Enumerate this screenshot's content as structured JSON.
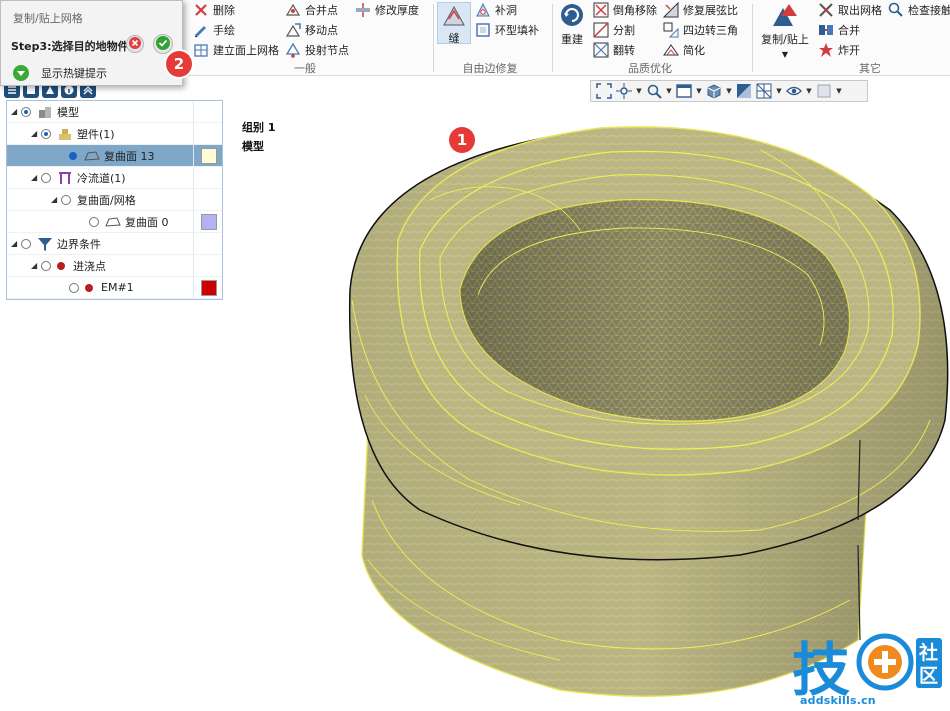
{
  "dialog": {
    "title": "复制/贴上网格",
    "step": "Step3:选择目的地物件",
    "hint": "显示热键提示"
  },
  "callouts": {
    "model": "1",
    "confirm": "2"
  },
  "ribbon": {
    "col1": [
      "删除",
      "手绘",
      "建立面上网格"
    ],
    "col2": [
      "合并点",
      "移动点",
      "投射节点"
    ],
    "col3": [
      "修改厚度"
    ],
    "group_general": "一般",
    "sew": "缝",
    "col4": [
      "补洞",
      "环型填补"
    ],
    "group_free_edge": "自由边修复",
    "rebuild": "重建",
    "col5": [
      "倒角移除",
      "分割",
      "翻转"
    ],
    "col6": [
      "修复展弦比",
      "四边转三角",
      "简化"
    ],
    "group_quality": "品质优化",
    "copy_paste": "复制/贴上",
    "col7": [
      "取出网格",
      "合并",
      "炸开"
    ],
    "check": "检查接触",
    "group_other": "其它"
  },
  "tree": {
    "rows": [
      {
        "label": "模型",
        "depth": 0,
        "expand": "◢",
        "radio": "on",
        "icon": "model",
        "swatch": ""
      },
      {
        "label": "塑件(1)",
        "depth": 1,
        "expand": "◢",
        "radio": "on",
        "icon": "part",
        "swatch": ""
      },
      {
        "label": "复曲面 13",
        "depth": 3,
        "expand": "",
        "radio": "dot",
        "icon": "surface",
        "swatch": "#fffbd6",
        "selected": true
      },
      {
        "label": "冷流道(1)",
        "depth": 1,
        "expand": "◢",
        "radio": "off",
        "icon": "runner",
        "swatch": ""
      },
      {
        "label": "复曲面/网格",
        "depth": 2,
        "expand": "◢",
        "radio": "off",
        "icon": "",
        "swatch": ""
      },
      {
        "label": "复曲面 0",
        "depth": 3,
        "expand": "",
        "radio": "off",
        "icon": "surface",
        "swatch": "#b2b2f5"
      },
      {
        "label": "边界条件",
        "depth": 0,
        "expand": "◢",
        "radio": "off",
        "icon": "funnel",
        "swatch": ""
      },
      {
        "label": "进浇点",
        "depth": 1,
        "expand": "◢",
        "radio": "off",
        "icon": "reddot",
        "swatch": ""
      },
      {
        "label": "EM#1",
        "depth": 2,
        "expand": "",
        "radio": "off",
        "icon": "reddot",
        "swatch": "#cc0000"
      }
    ]
  },
  "viewport": {
    "group_label": "组别 1",
    "model_label": "模型"
  },
  "watermark": {
    "brand": "技",
    "side_text": [
      "社",
      "区"
    ],
    "url": "addskills.cn"
  },
  "colors": {
    "accent": "#1f4f7f",
    "callout": "#e53a37",
    "mesh_face": "#bdb893",
    "mesh_line": "#f0ee55",
    "selection": "#7ea7c8"
  }
}
